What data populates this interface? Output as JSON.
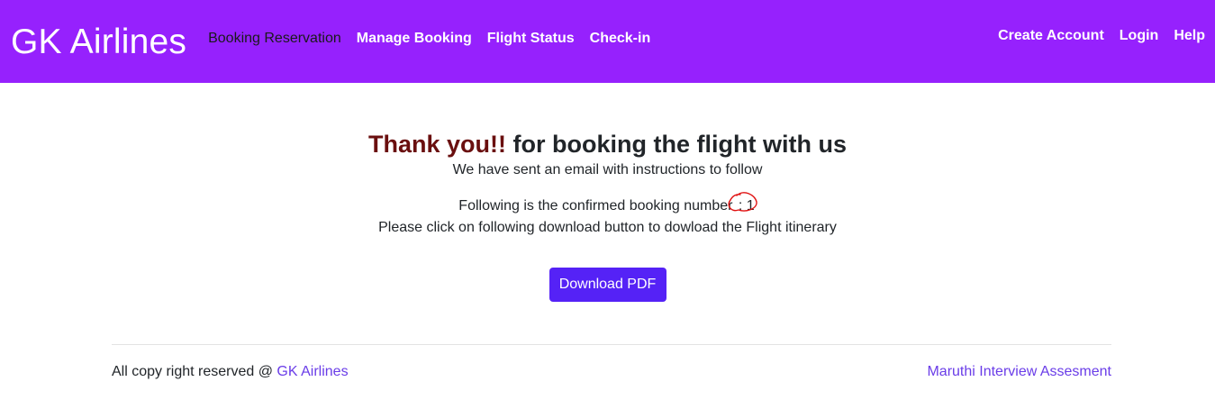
{
  "nav": {
    "brand": "GK Airlines",
    "left_items": [
      "Booking Reservation",
      "Manage Booking",
      "Flight Status",
      "Check-in"
    ],
    "right_items": [
      "Create Account",
      "Login",
      "Help"
    ]
  },
  "confirmation": {
    "heading_accent": "Thank you!!",
    "heading_rest": " for booking the flight with us",
    "email_note": "We have sent an email with instructions to follow",
    "booking_label": "Following is the confirmed booking number ",
    "booking_number": ": 1",
    "itinerary_note": "Please click on following download button to dowload the Flight itinerary",
    "download_label": "Download PDF"
  },
  "footer": {
    "copyright": "All copy right reserved @ ",
    "copyright_link": "GK Airlines",
    "right_link": "Maruthi Interview Assesment"
  },
  "colors": {
    "navbar_bg": "#9621fd",
    "button_bg": "#5522f6",
    "accent_text": "#6a0f0f",
    "annotation": "#e01010"
  }
}
